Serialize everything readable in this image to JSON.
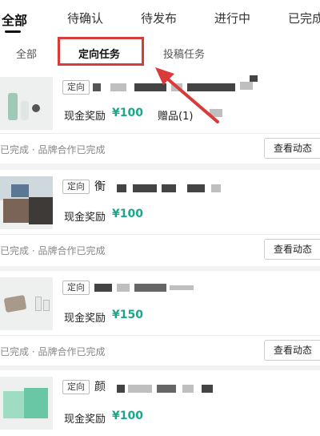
{
  "top_tabs": [
    "全部",
    "待确认",
    "待发布",
    "进行中",
    "已完成"
  ],
  "sub_tabs": [
    "全部",
    "定向任务",
    "投稿任务"
  ],
  "colors": {
    "accent": "#1aa88c",
    "highlight": "#d93a3a"
  },
  "tasks": [
    {
      "tag": "定向",
      "reward_label": "现金奖励",
      "reward_value": "¥100",
      "gift": "赠品(1)",
      "status": "已完成 · 品牌合作已完成",
      "button": "查看动态"
    },
    {
      "tag": "定向",
      "title_char": "衡",
      "reward_label": "现金奖励",
      "reward_value": "¥100",
      "status": "已完成 · 品牌合作已完成",
      "button": "查看动态"
    },
    {
      "tag": "定向",
      "reward_label": "现金奖励",
      "reward_value": "¥150",
      "status": "已完成 · 品牌合作已完成",
      "button": "查看动态"
    },
    {
      "tag": "定向",
      "title_char": "颜",
      "reward_label": "现金奖励",
      "reward_value": "¥100"
    }
  ]
}
